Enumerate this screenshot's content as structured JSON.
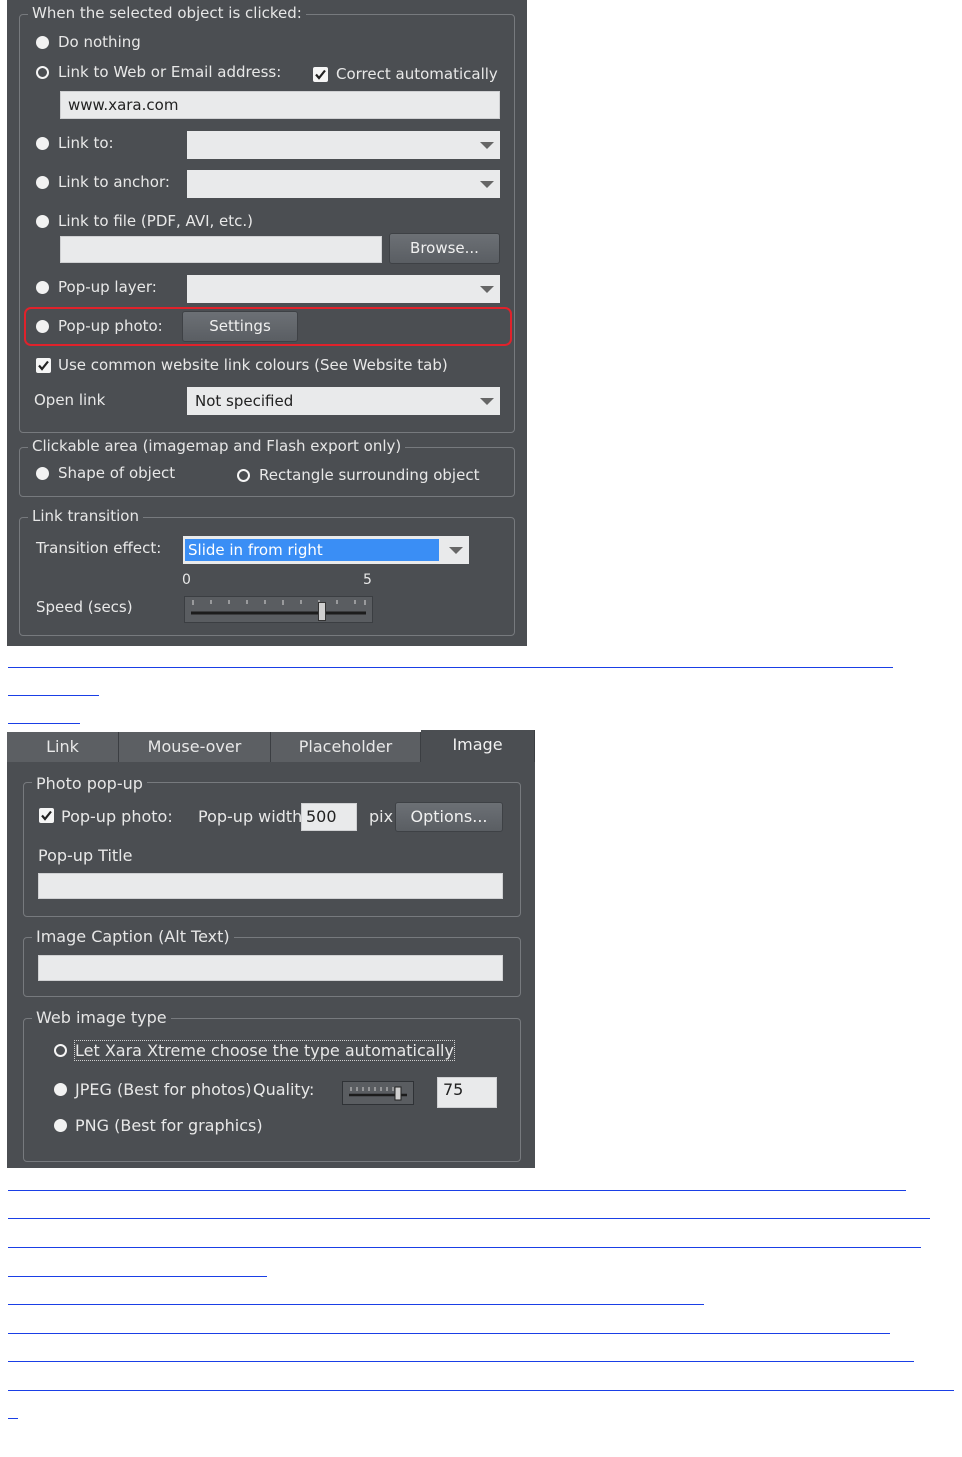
{
  "panel1": {
    "group_title": "When the selected object is clicked:",
    "do_nothing": "Do nothing",
    "link_web": "Link to Web or Email address:",
    "correct_auto": "Correct automatically",
    "url_value": "www.xara.com",
    "link_to": "Link to:",
    "link_anchor": "Link to anchor:",
    "link_file": "Link to file (PDF, AVI, etc.)",
    "browse": "Browse...",
    "popup_layer": "Pop-up layer:",
    "popup_photo": "Pop-up photo:",
    "settings": "Settings",
    "common_colours": "Use common website link colours (See Website tab)",
    "open_link": "Open link",
    "open_link_value": "Not specified",
    "clickable_title": "Clickable area (imagemap and Flash export only)",
    "shape_of_object": "Shape of object",
    "rect_surrounding": "Rectangle surrounding object",
    "transition_title": "Link transition",
    "transition_effect": "Transition effect:",
    "transition_value": "Slide in from right",
    "speed_min": "0",
    "speed_max": "5",
    "speed_label": "Speed (secs)",
    "speed_fraction": 0.75,
    "highlight_color": "#e0222b"
  },
  "panel2": {
    "tabs": [
      "Link",
      "Mouse-over",
      "Placeholder",
      "Image"
    ],
    "active_tab": "Image",
    "photo_group": "Photo pop-up",
    "popup_photo": "Pop-up photo:",
    "popup_width": "Pop-up width:",
    "width_value": "500",
    "pix": "pix",
    "options": "Options...",
    "popup_title": "Pop-up Title",
    "caption_group": "Image Caption (Alt Text)",
    "web_type_group": "Web image type",
    "auto_type": "Let Xara Xtreme choose the type automatically",
    "jpeg": "JPEG (Best for photos)",
    "quality": "Quality:",
    "quality_value": "75",
    "png": "PNG (Best for graphics)"
  },
  "link_color": "#1a3fe6"
}
